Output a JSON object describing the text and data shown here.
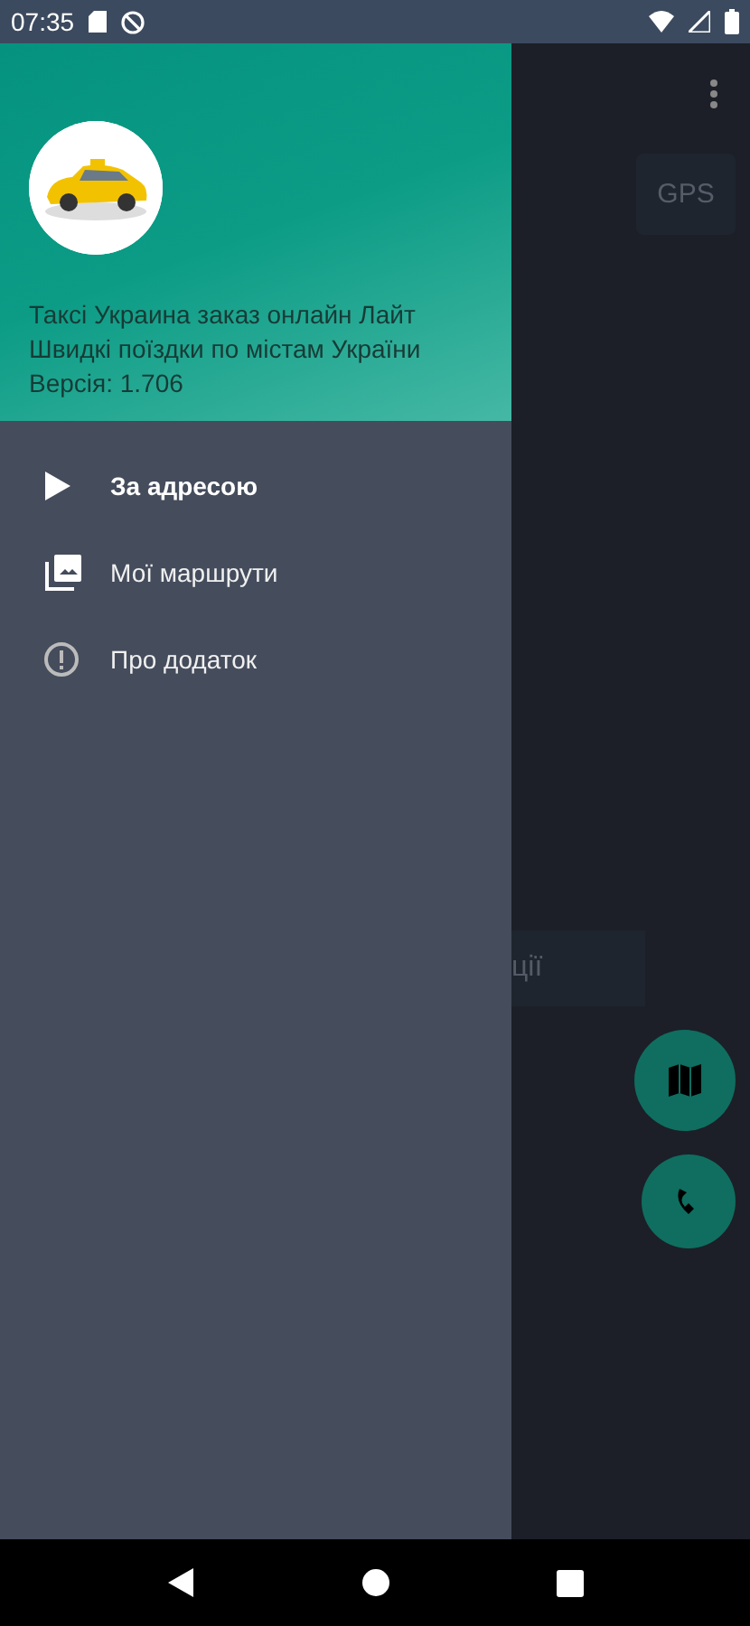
{
  "status_bar": {
    "time": "07:35"
  },
  "drawer": {
    "header": {
      "title": "Таксі Украина заказ онлайн Лайт",
      "subtitle": "Швидкі поїздки по містам України",
      "version": "Версія: 1.706"
    },
    "items": [
      {
        "label": "За адресою",
        "selected": true
      },
      {
        "label": "Мої маршрути",
        "selected": false
      },
      {
        "label": "Про додаток",
        "selected": false
      }
    ]
  },
  "background": {
    "gps_button": "GPS",
    "field_text": "ції"
  }
}
